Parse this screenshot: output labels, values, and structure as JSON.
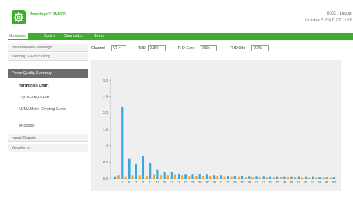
{
  "header": {
    "brand": "Powerlogic™ PM8000",
    "user": "8000 | Logout",
    "datetime": "October 5 2017, 07:12:09"
  },
  "menu": [
    {
      "label": "Monitoring",
      "active": true
    },
    {
      "label": "Control",
      "active": false
    },
    {
      "label": "Diagnostics",
      "active": false
    },
    {
      "label": "Setup",
      "active": false
    }
  ],
  "sidebar": {
    "items": [
      {
        "label": "Instantaneous Readings",
        "kind": "section"
      },
      {
        "label": "Trending & Forecasting",
        "kind": "section"
      },
      {
        "label": "Power Quality Summary",
        "kind": "group"
      },
      {
        "label": "Harmonics Chart",
        "kind": "sub",
        "active": true
      },
      {
        "label": "ITI(CBEMA)-SEMI",
        "kind": "sub"
      },
      {
        "label": "NEMA Motor Derating Curve",
        "kind": "sub"
      },
      {
        "label": "EN50160",
        "kind": "sub"
      },
      {
        "label": "Inputs/Outputs",
        "kind": "section"
      },
      {
        "label": "Waveforms",
        "kind": "section"
      }
    ]
  },
  "toolbar": {
    "channel_label": "Channel",
    "channel_value": "V1",
    "thd_label": "THD",
    "thd_value": "2.3%",
    "thd_even_label": "THD Even",
    "thd_even_value": "0.5%",
    "thd_odd_label": "THD Odd",
    "thd_odd_value": "2.3%"
  },
  "colors": {
    "brand_green": "#3dae2b",
    "odd_bar": "#3aa8dc",
    "even_bar": "#f0a830"
  },
  "chart_data": {
    "type": "bar",
    "ylim": [
      0,
      3.0
    ],
    "yticks": [
      "0.0",
      "0.5",
      "1.0",
      "1.5",
      "2.0",
      "2.5",
      "3.0"
    ],
    "xtick_labels": [
      "1",
      "3",
      "5",
      "7",
      "9",
      "11",
      "13",
      "15",
      "17",
      "19",
      "21",
      "23",
      "25",
      "27",
      "29",
      "31",
      "33",
      "35",
      "37",
      "39",
      "41",
      "43",
      "45",
      "47",
      "49",
      "51",
      "53",
      "55",
      "57",
      "59",
      "61",
      "63"
    ],
    "harmonics": [
      1,
      2,
      3,
      4,
      5,
      6,
      7,
      8,
      9,
      10,
      11,
      12,
      13,
      14,
      15,
      16,
      17,
      18,
      19,
      20,
      21,
      22,
      23,
      24,
      25,
      26,
      27,
      28,
      29,
      30,
      31,
      32,
      33,
      34,
      35,
      36,
      37,
      38,
      39,
      40,
      41,
      42,
      43,
      44,
      45,
      46,
      47,
      48,
      49,
      50,
      51,
      52,
      53,
      54,
      55,
      56,
      57,
      58,
      59,
      60,
      61,
      62,
      63
    ],
    "values": [
      0.05,
      0.1,
      2.2,
      0.05,
      0.6,
      0.1,
      0.45,
      0.1,
      0.68,
      0.08,
      0.48,
      0.12,
      0.28,
      0.1,
      0.2,
      0.1,
      0.2,
      0.12,
      0.15,
      0.1,
      0.12,
      0.08,
      0.12,
      0.08,
      0.14,
      0.08,
      0.12,
      0.07,
      0.1,
      0.06,
      0.1,
      0.05,
      0.08,
      0.05,
      0.07,
      0.05,
      0.07,
      0.04,
      0.06,
      0.04,
      0.06,
      0.04,
      0.06,
      0.04,
      0.05,
      0.04,
      0.05,
      0.04,
      0.05,
      0.04,
      0.05,
      0.04,
      0.05,
      0.03,
      0.05,
      0.03,
      0.05,
      0.03,
      0.04,
      0.03,
      0.04,
      0.03,
      0.04
    ]
  }
}
